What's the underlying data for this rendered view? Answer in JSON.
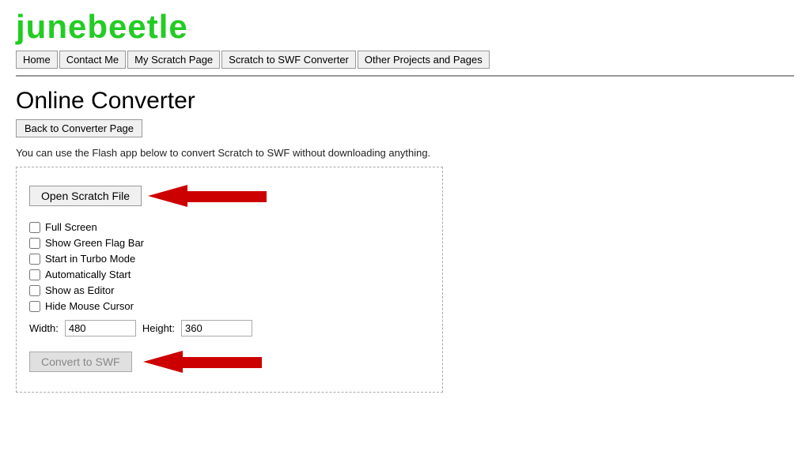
{
  "logo": {
    "text": "junebeetle"
  },
  "nav": {
    "items": [
      {
        "label": "Home",
        "name": "home"
      },
      {
        "label": "Contact Me",
        "name": "contact-me"
      },
      {
        "label": "My Scratch Page",
        "name": "my-scratch-page"
      },
      {
        "label": "Scratch to SWF Converter",
        "name": "scratch-to-swf-converter"
      },
      {
        "label": "Other Projects and Pages",
        "name": "other-projects-and-pages"
      }
    ]
  },
  "page": {
    "heading": "Online Converter",
    "back_button": "Back to Converter Page",
    "description": "You can use the Flash app below to convert Scratch to SWF without downloading anything."
  },
  "converter": {
    "open_scratch_file": "Open Scratch File",
    "checkboxes": [
      {
        "label": "Full Screen",
        "checked": false
      },
      {
        "label": "Show Green Flag Bar",
        "checked": false
      },
      {
        "label": "Start in Turbo Mode",
        "checked": false
      },
      {
        "label": "Automatically Start",
        "checked": false
      },
      {
        "label": "Show as Editor",
        "checked": false
      },
      {
        "label": "Hide Mouse Cursor",
        "checked": false
      }
    ],
    "width_label": "Width:",
    "width_value": "480",
    "height_label": "Height:",
    "height_value": "360",
    "convert_button": "Convert to SWF"
  }
}
